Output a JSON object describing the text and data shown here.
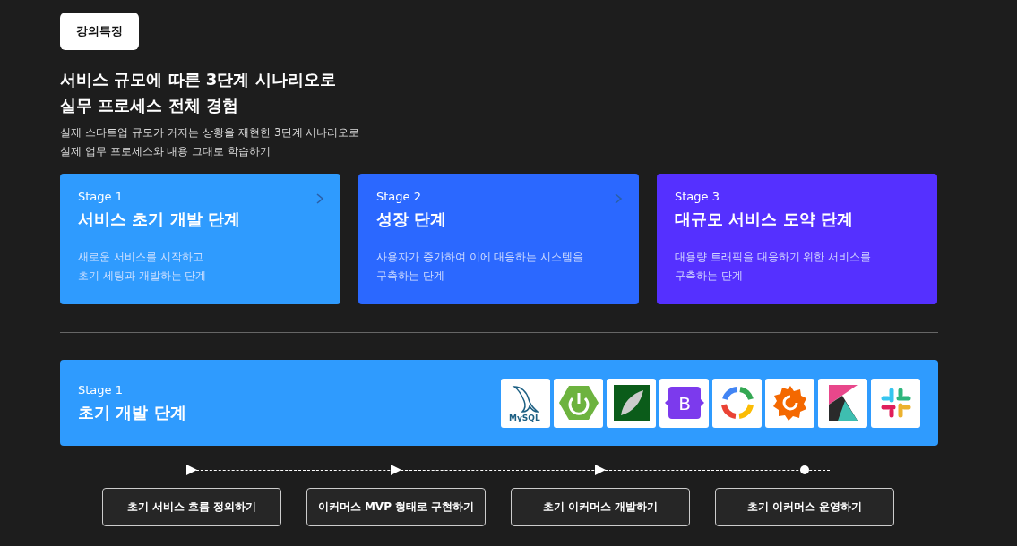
{
  "badge": "강의특징",
  "headline": [
    "서비스 규모에 따른 3단계 시나리오로",
    "실무 프로세스 전체 경험"
  ],
  "description": [
    "실제 스타트업 규모가 커지는 상황을 재현한 3단계 시나리오로",
    "실제 업무 프로세스와 내용 그대로 학습하기"
  ],
  "stages": [
    {
      "label": "Stage 1",
      "title": "서비스 초기 개발 단계",
      "text": [
        "새로운 서비스를 시작하고",
        "초기 세팅과 개발하는 단계"
      ],
      "color": "#2f9bfe",
      "arrow": true
    },
    {
      "label": "Stage 2",
      "title": "성장 단계",
      "text": [
        "사용자가 증가하여 이에 대응하는 시스템을",
        "구축하는 단계"
      ],
      "color": "#2b68ff",
      "arrow": true
    },
    {
      "label": "Stage 3",
      "title": "대규모 서비스 도약 단계",
      "text": [
        "대용량 트래픽을 대응하기 위한 서비스를",
        "구축하는 단계"
      ],
      "color": "#5530ff",
      "arrow": false
    }
  ],
  "detail": {
    "label": "Stage 1",
    "title": "초기 개발 단계",
    "logos": [
      {
        "kind": "dolphin",
        "label": "MySQL"
      },
      {
        "kind": "power"
      },
      {
        "kind": "leaf"
      },
      {
        "kind": "letter",
        "label": "B"
      },
      {
        "kind": "ring"
      },
      {
        "kind": "gear"
      },
      {
        "kind": "k"
      },
      {
        "kind": "hash"
      }
    ]
  },
  "steps": [
    {
      "label": "초기 서비스 흐름 정의하기",
      "kind": "arrow"
    },
    {
      "label": "이커머스 MVP 형태로 구현하기",
      "kind": "arrow"
    },
    {
      "label": "초기 이커머스 개발하기",
      "kind": "arrow"
    },
    {
      "label": "초기 이커머스 운영하기",
      "kind": "dot"
    }
  ]
}
